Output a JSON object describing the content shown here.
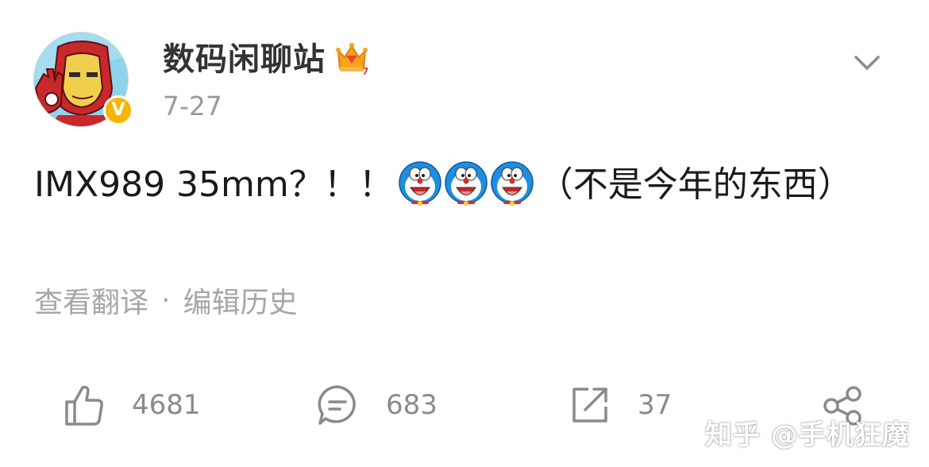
{
  "post": {
    "author": {
      "name": "数码闲聊站",
      "verified_badge_letter": "V",
      "vip_level": "7"
    },
    "time": "7-27",
    "text_before_emoji": "IMX989 35mm？！！",
    "text_after_emoji": "（不是今年的东西）",
    "emoji_icons": [
      "doraemon-emoji",
      "doraemon-emoji",
      "doraemon-emoji"
    ],
    "actions": {
      "translate_label": "查看翻译",
      "separator": "·",
      "edit_history_label": "编辑历史"
    }
  },
  "footer": {
    "likes": "4681",
    "comments": "683",
    "reposts": "37"
  },
  "watermark": "知乎 @手机狂魔",
  "colors": {
    "badge": "#f7b500",
    "meta_text": "#9a9a9a",
    "icon_gray": "#8a8a8a"
  }
}
